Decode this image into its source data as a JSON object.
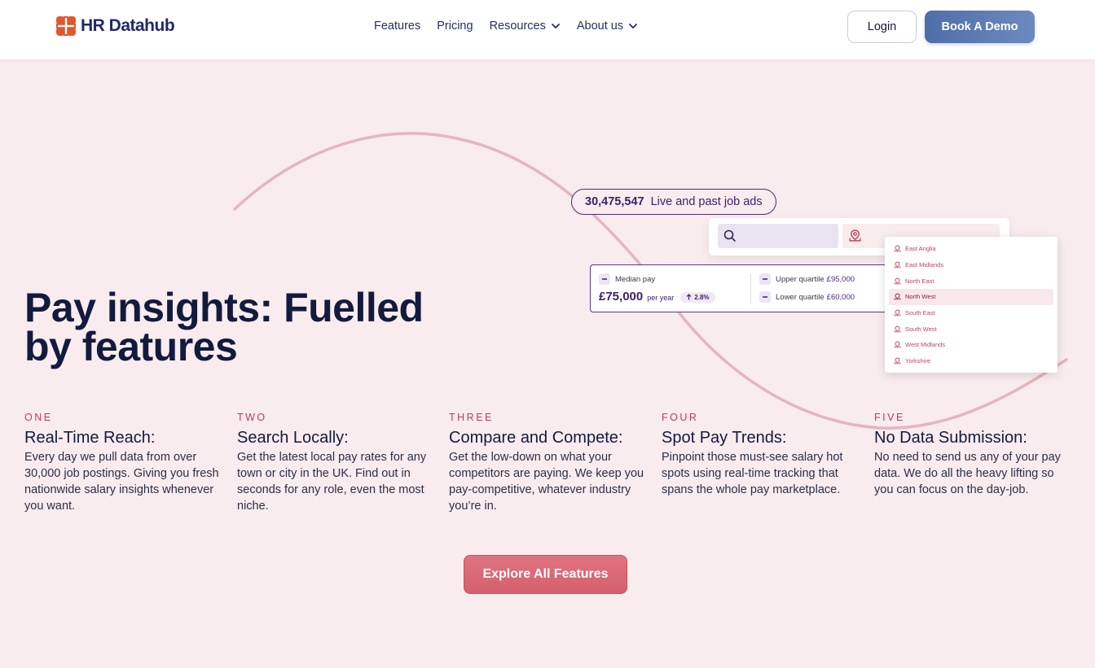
{
  "brand": {
    "name": "HR Datahub",
    "colors": {
      "orange": "#e3552b",
      "navy": "#1f2a6b",
      "accent_pink": "#c23a56",
      "purple": "#3c1f6b"
    }
  },
  "nav": {
    "items": [
      {
        "label": "Features",
        "dropdown": false
      },
      {
        "label": "Pricing",
        "dropdown": false
      },
      {
        "label": "Resources",
        "dropdown": true
      },
      {
        "label": "About us",
        "dropdown": true
      }
    ],
    "login_label": "Login",
    "demo_label": "Book A Demo"
  },
  "hero": {
    "title": "Pay insights: Fuelled by features"
  },
  "mock": {
    "job_count": "30,475,547",
    "job_count_label": "Live and past job ads",
    "median_label": "Median pay",
    "median_value": "£75,000",
    "median_period": "per year",
    "median_change": "2.8%",
    "upper_label": "Upper quartile",
    "upper_value": "£95,000",
    "lower_label": "Lower quartile",
    "lower_value": "£60,000",
    "regions": [
      "East Anglia",
      "East Midlands",
      "North East",
      "North West",
      "South East",
      "South West",
      "West Midlands",
      "Yorkshire"
    ],
    "selected_region": "North West"
  },
  "features": [
    {
      "num": "ONE",
      "title": "Real-Time Reach:",
      "desc": "Every day we pull data from over 30,000 job postings. Giving you fresh nationwide salary insights whenever you want."
    },
    {
      "num": "TWO",
      "title": "Search Locally:",
      "desc": "Get the latest local pay rates for any town or city in the UK. Find out in seconds for any role, even the most niche."
    },
    {
      "num": "THREE",
      "title": "Compare and Compete:",
      "desc": "Get the low-down on what your competitors are paying. We keep you pay-competitive, whatever industry you’re in."
    },
    {
      "num": "FOUR",
      "title": "Spot Pay Trends:",
      "desc": "Pinpoint those must-see salary hot spots using real-time tracking that spans the whole pay marketplace."
    },
    {
      "num": "FIVE",
      "title": "No Data Submission:",
      "desc": "No need to send us any of your pay data. We do all the heavy lifting so you can focus on the day-job."
    }
  ],
  "cta": {
    "label": "Explore All Features"
  }
}
